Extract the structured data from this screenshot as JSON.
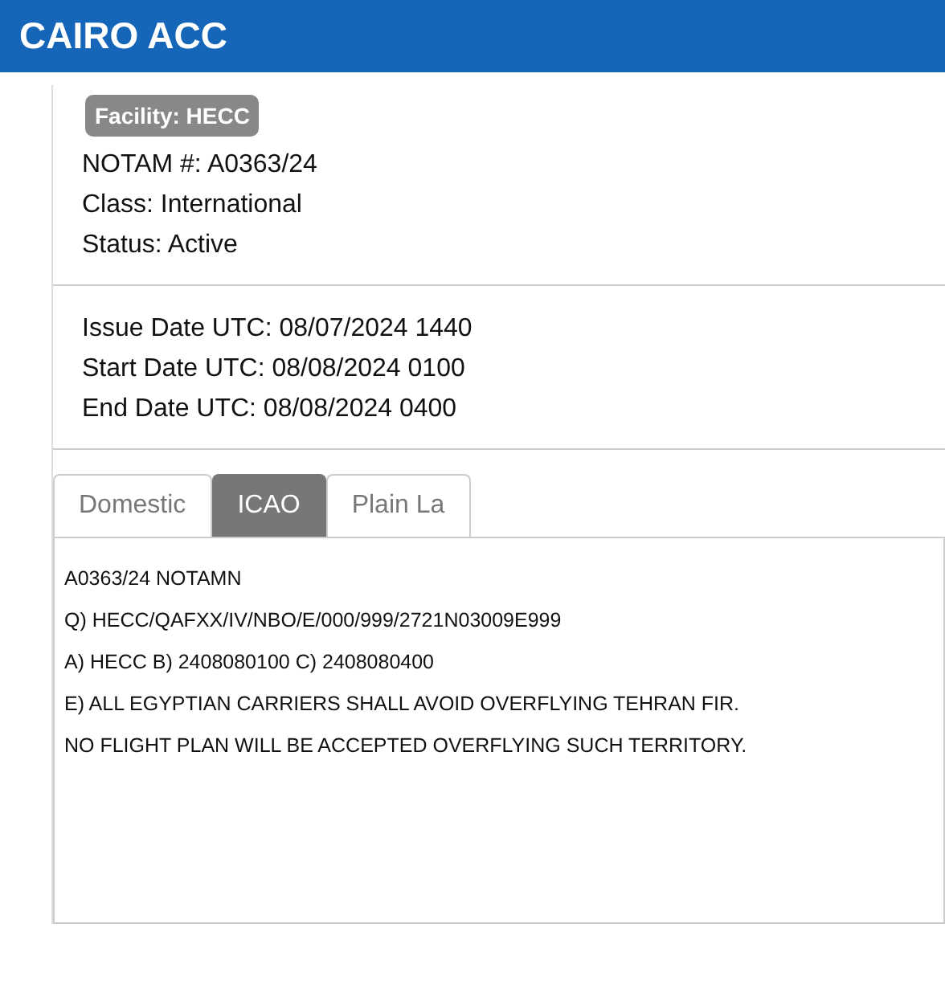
{
  "header": {
    "title": "CAIRO ACC"
  },
  "facility_badge": "Facility:  HECC",
  "details": [
    "NOTAM #: A0363/24",
    "Class: International",
    "Status: Active"
  ],
  "dates": [
    "Issue Date UTC: 08/07/2024 1440",
    "Start Date UTC: 08/08/2024 0100",
    "End Date UTC: 08/08/2024 0400"
  ],
  "tabs": [
    {
      "label": "Domestic",
      "selected": false
    },
    {
      "label": "ICAO",
      "selected": true
    },
    {
      "label": "Plain La",
      "selected": false
    }
  ],
  "notam_text": [
    "A0363/24 NOTAMN",
    "Q) HECC/QAFXX/IV/NBO/E/000/999/2721N03009E999",
    "A) HECC B) 2408080100 C) 2408080400",
    "E) ALL EGYPTIAN CARRIERS SHALL AVOID OVERFLYING TEHRAN FIR.",
    "NO FLIGHT PLAN WILL BE ACCEPTED OVERFLYING SUCH TERRITORY."
  ]
}
